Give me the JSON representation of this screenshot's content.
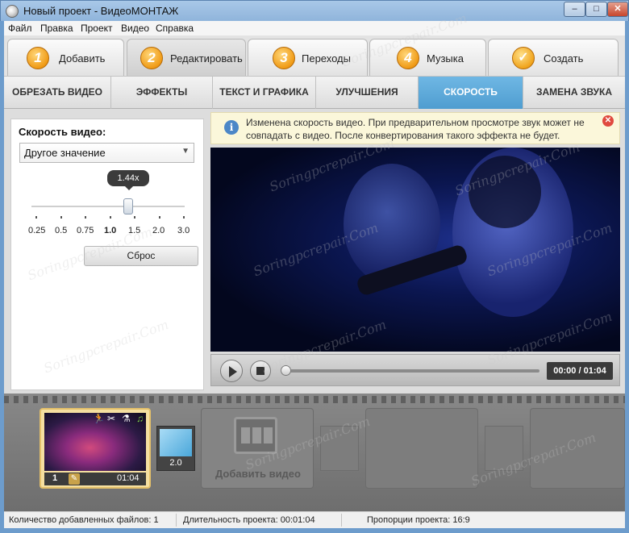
{
  "window": {
    "title": "Новый проект - ВидеоМОНТАЖ",
    "minimize": "–",
    "maximize": "□",
    "close": "✕"
  },
  "menu": [
    "Файл",
    "Правка",
    "Проект",
    "Видео",
    "Справка"
  ],
  "steps": [
    {
      "num": "1",
      "label": "Добавить"
    },
    {
      "num": "2",
      "label": "Редактировать"
    },
    {
      "num": "3",
      "label": "Переходы"
    },
    {
      "num": "4",
      "label": "Музыка"
    },
    {
      "num": "✓",
      "label": "Создать"
    }
  ],
  "subtabs": [
    "ОБРЕЗАТЬ ВИДЕО",
    "ЭФФЕКТЫ",
    "ТЕКСТ И ГРАФИКА",
    "УЛУЧШЕНИЯ",
    "СКОРОСТЬ",
    "ЗАМЕНА ЗВУКА"
  ],
  "speed": {
    "title": "Скорость видео:",
    "preset": "Другое значение",
    "current": "1.44x",
    "ticks": [
      "0.25",
      "0.5",
      "0.75",
      "1.0",
      "1.5",
      "2.0",
      "3.0"
    ],
    "reset": "Сброс"
  },
  "notice": {
    "line1": "Изменена скорость видео. При предварительном просмотре звук может не",
    "line2": "совпадать с видео. После конвертирования такого эффекта не будет."
  },
  "player": {
    "time": "00:00 / 01:04",
    "progress": 0
  },
  "timeline": {
    "clip_index": "1",
    "clip_duration": "01:04",
    "transition_value": "2.0",
    "add_video": "Добавить видео"
  },
  "status": {
    "files": "Количество добавленных файлов: 1",
    "duration": "Длительность проекта:  00:01:04",
    "ratio": "Пропорции проекта:  16:9"
  },
  "watermark": "Soringpcrepair.Com",
  "colors": {
    "accent": "#4f9dd0",
    "step_badge": "#f09b16",
    "notice_bg": "#fbf7da"
  }
}
